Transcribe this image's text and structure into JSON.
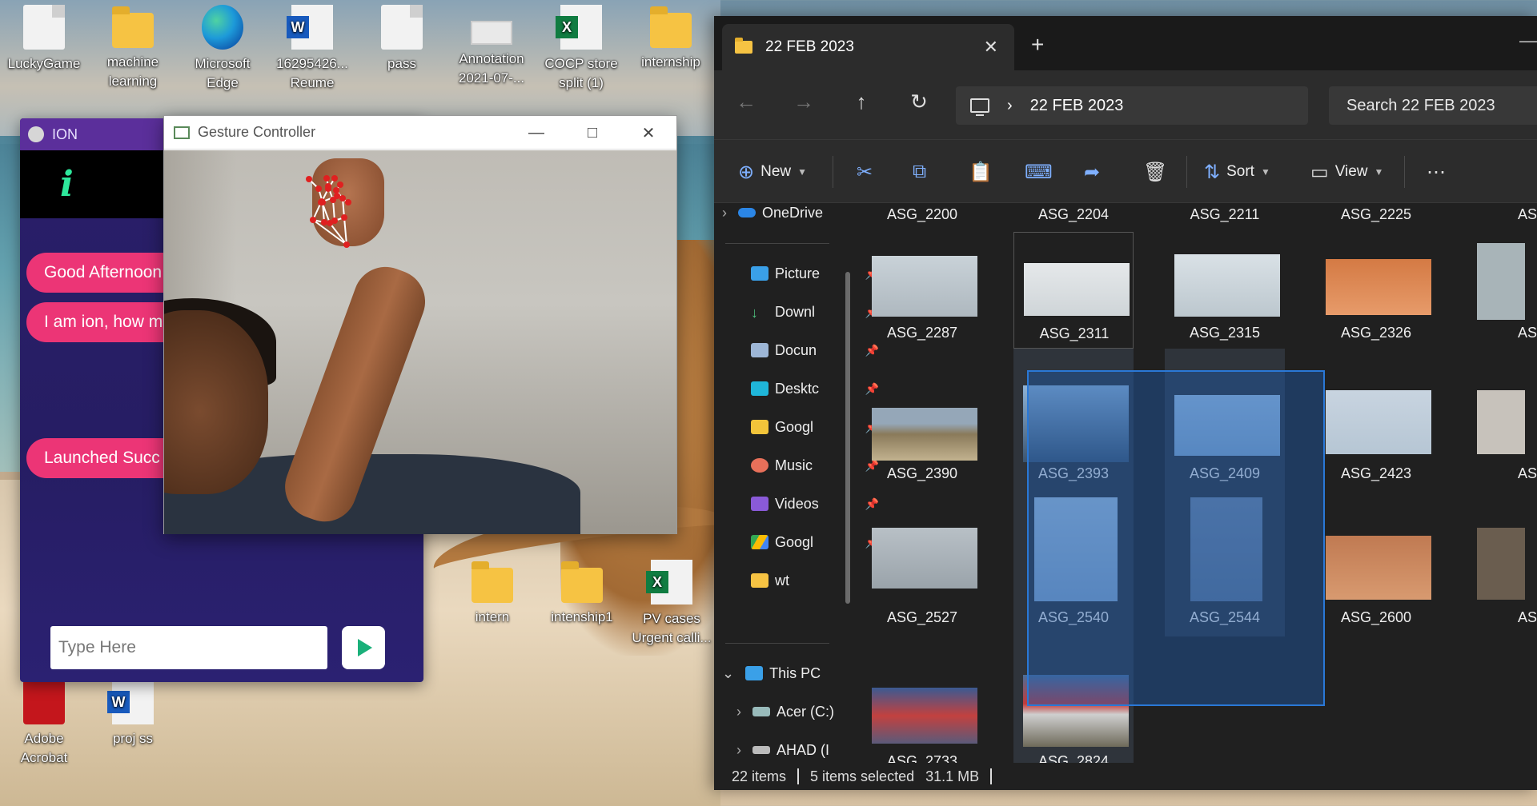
{
  "desktop": {
    "icons": [
      {
        "label": "LuckyGame",
        "type": "file"
      },
      {
        "label": "machine learning",
        "type": "folder"
      },
      {
        "label": "Microsoft Edge",
        "type": "edge"
      },
      {
        "label": "16295426... Reume",
        "type": "word"
      },
      {
        "label": "pass",
        "type": "file"
      },
      {
        "label": "Annotation 2021-07-...",
        "type": "shot"
      },
      {
        "label": "COCP store split (1)",
        "type": "excel"
      },
      {
        "label": "internship",
        "type": "folder"
      },
      {
        "label": "intern",
        "type": "folder"
      },
      {
        "label": "intenship1",
        "type": "folder"
      },
      {
        "label": "PV cases Urgent calli...",
        "type": "excel"
      },
      {
        "label": "Adobe Acrobat",
        "type": "pdf"
      },
      {
        "label": "proj ss",
        "type": "word"
      }
    ]
  },
  "ion": {
    "title": "ION",
    "messages": [
      "Good Afternoon",
      "I am ion, how m",
      "Launched Succ"
    ],
    "input_placeholder": "Type Here"
  },
  "gesture": {
    "title": "Gesture Controller"
  },
  "explorer": {
    "tab_title": "22 FEB 2023",
    "address": "22 FEB 2023",
    "search_placeholder": "Search 22 FEB 2023",
    "commands": {
      "new": "New",
      "sort": "Sort",
      "view": "View"
    },
    "nav": {
      "onedrive": "OneDrive",
      "quick": [
        "Picture",
        "Downl",
        "Docun",
        "Desktc",
        "Googl",
        "Music",
        "Videos",
        "Googl",
        "wt"
      ],
      "this_pc": "This PC",
      "drives": [
        "Acer (C:)",
        "AHAD (I"
      ]
    },
    "files": {
      "row0": [
        "ASG_2200",
        "ASG_2204",
        "ASG_2211",
        "ASG_2225",
        "AS"
      ],
      "row1": [
        "ASG_2287",
        "ASG_2311",
        "ASG_2315",
        "ASG_2326",
        "AS"
      ],
      "row2": [
        "ASG_2390",
        "ASG_2393",
        "ASG_2409",
        "ASG_2423",
        "AS"
      ],
      "row3": [
        "ASG_2527",
        "ASG_2540",
        "ASG_2544",
        "ASG_2600",
        "AS"
      ],
      "row4": [
        "ASG_2733",
        "ASG_2824"
      ]
    },
    "status": {
      "items": "22 items",
      "selected": "5 items selected",
      "size": "31.1 MB"
    },
    "colors": {
      "accent": "#2a78d6",
      "folder": "#f6c343"
    }
  }
}
